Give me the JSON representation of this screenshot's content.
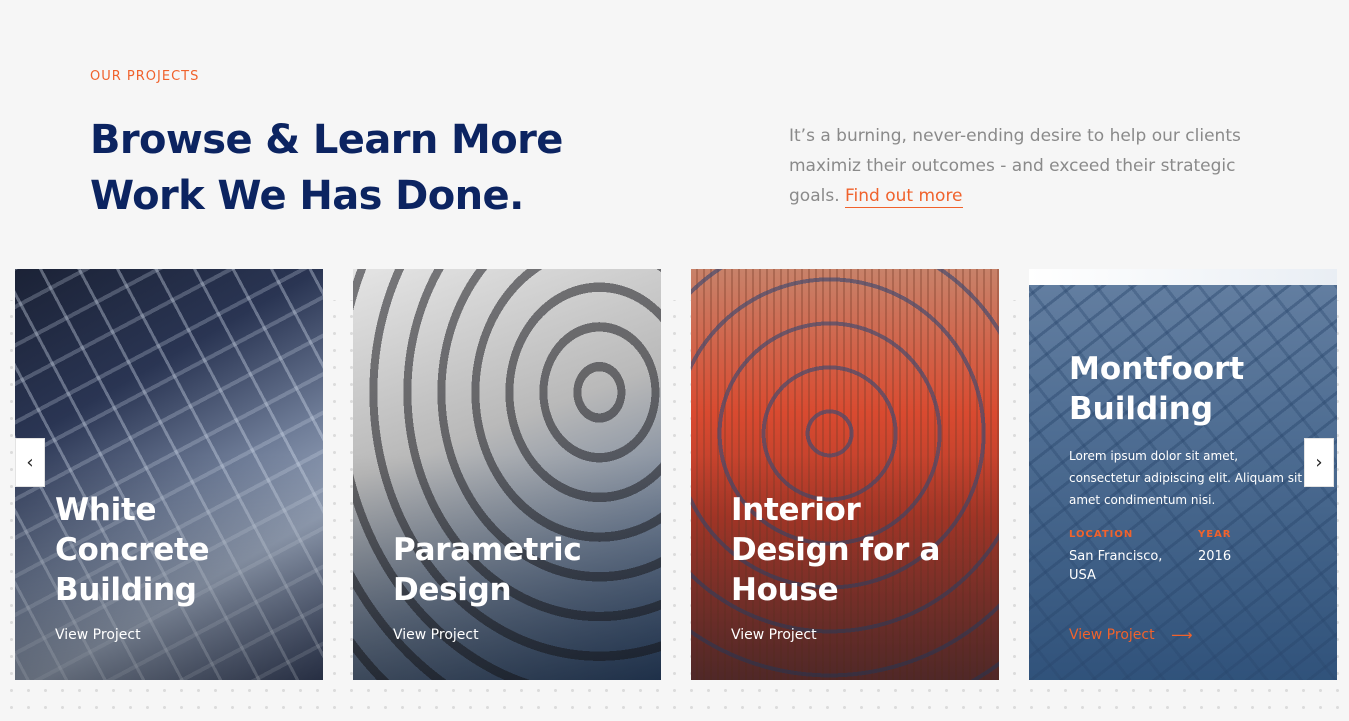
{
  "section": {
    "eyebrow": "OUR PROJECTS",
    "headline_line1": "Browse & Learn More",
    "headline_line2": "Work We Has Done.",
    "intro_line1": "It’s a burning, never-ending desire to help our clients",
    "intro_line2": "maximiz their outcomes - and exceed their strategic",
    "intro_line3_prefix": "goals.",
    "find_out_more": "Find out more"
  },
  "projects": [
    {
      "title": "White Concrete Building",
      "link": "View Project"
    },
    {
      "title": "Parametric Design",
      "link": "View Project"
    },
    {
      "title": "Interior Design for a House",
      "link": "View Project"
    },
    {
      "title": "Montfoort Building",
      "description": "Lorem ipsum dolor sit amet, consectetur adipiscing elit. Aliquam sit amet condimentum nisi.",
      "location_label": "LOCATION",
      "location_value": "San Francisco, USA",
      "year_label": "YEAR",
      "year_value": "2016",
      "link": "View Project",
      "arrow_icon": "arrow-right-icon"
    }
  ],
  "nav": {
    "prev_icon": "‹",
    "next_icon": "›"
  },
  "colors": {
    "accent": "#f0622c",
    "heading": "#0c2461",
    "body_text": "#8a8a8a",
    "background": "#f6f6f6"
  }
}
